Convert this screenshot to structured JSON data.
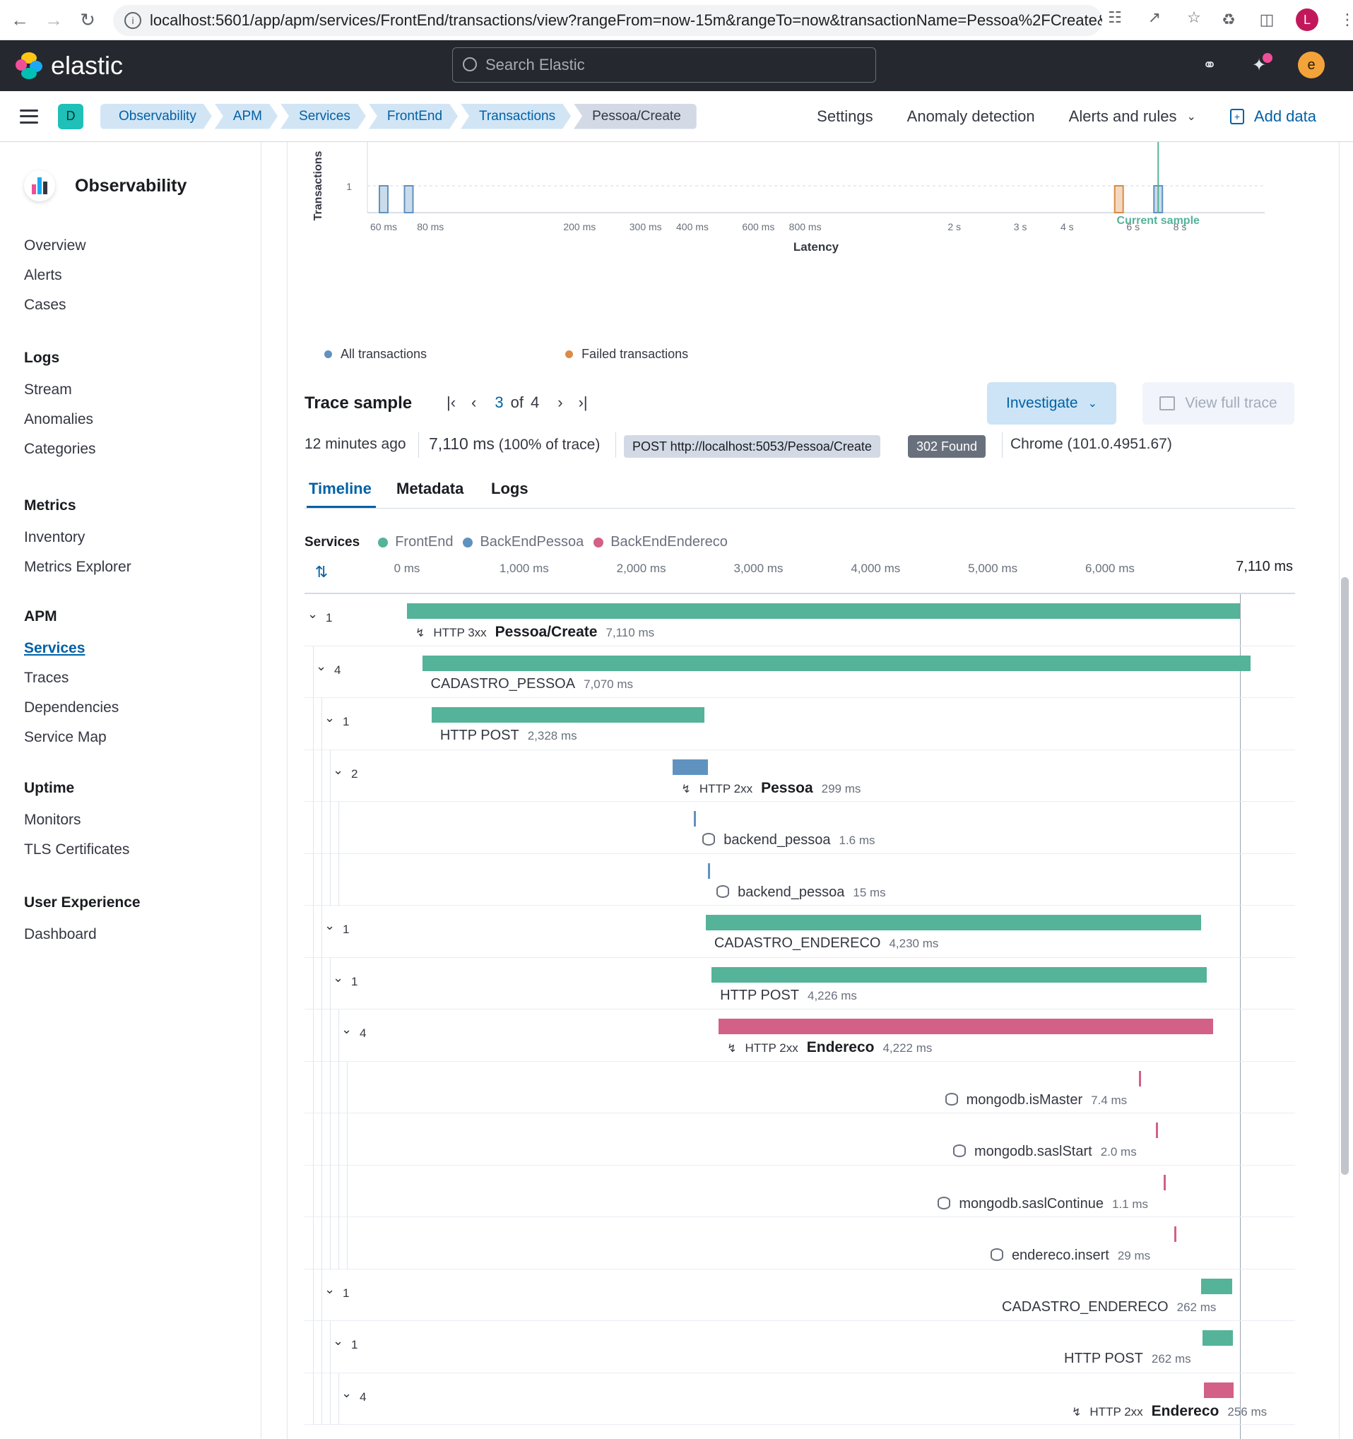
{
  "browser": {
    "url": "localhost:5601/app/apm/services/FrontEnd/transactions/view?rangeFrom=now-15m&rangeTo=now&transactionName=Pessoa%2FCreate&tra...",
    "profile_initial": "L"
  },
  "header": {
    "brand": "elastic",
    "search_placeholder": "Search Elastic",
    "user_initial": "e"
  },
  "breadcrumbs": {
    "space": "D",
    "items": [
      "Observability",
      "APM",
      "Services",
      "FrontEnd",
      "Transactions",
      "Pessoa/Create"
    ],
    "links": [
      "Settings",
      "Anomaly detection",
      "Alerts and rules",
      "Add data"
    ]
  },
  "sidebar": {
    "title": "Observability",
    "top": [
      "Overview",
      "Alerts",
      "Cases"
    ],
    "groups": [
      {
        "title": "Logs",
        "items": [
          "Stream",
          "Anomalies",
          "Categories"
        ]
      },
      {
        "title": "Metrics",
        "items": [
          "Inventory",
          "Metrics Explorer"
        ]
      },
      {
        "title": "APM",
        "items": [
          "Services",
          "Traces",
          "Dependencies",
          "Service Map"
        ]
      },
      {
        "title": "Uptime",
        "items": [
          "Monitors",
          "TLS Certificates"
        ]
      },
      {
        "title": "User Experience",
        "items": [
          "Dashboard"
        ]
      }
    ],
    "active": "Services"
  },
  "chart_data": {
    "type": "bar",
    "ylabel": "Transactions",
    "xlabel": "Latency",
    "x_scale": "log",
    "x_ticks": [
      "60 ms",
      "80 ms",
      "200 ms",
      "300 ms",
      "400 ms",
      "600 ms",
      "800 ms",
      "2 s",
      "3 s",
      "4 s",
      "6 s",
      "8 s"
    ],
    "y_ticks": [
      "1"
    ],
    "series": [
      {
        "name": "All transactions",
        "color": "#6092c0",
        "x": [
          "60 ms",
          "70 ms",
          "7 s"
        ],
        "values": [
          1,
          1,
          1
        ]
      },
      {
        "name": "Failed transactions",
        "color": "#da8b45",
        "x": [
          "5.5 s"
        ],
        "values": [
          1
        ]
      }
    ],
    "annotation": "Current sample",
    "legend": [
      "All transactions",
      "Failed transactions"
    ]
  },
  "trace": {
    "title": "Trace sample",
    "current": "3",
    "of": "of",
    "total": "4",
    "investigate": "Investigate",
    "view_full_trace": "View full trace",
    "time_ago": "12 minutes ago",
    "duration": "7,110 ms",
    "duration_pct": "(100% of trace)",
    "request": "POST http://localhost:5053/Pessoa/Create",
    "status": "302 Found",
    "agent": "Chrome (101.0.4951.67)",
    "tabs": [
      "Timeline",
      "Metadata",
      "Logs"
    ]
  },
  "timeline": {
    "services_label": "Services",
    "services": [
      {
        "name": "FrontEnd",
        "color": "#54b399"
      },
      {
        "name": "BackEndPessoa",
        "color": "#6092c0"
      },
      {
        "name": "BackEndEndereco",
        "color": "#d36086"
      }
    ],
    "axis": [
      "0 ms",
      "1,000 ms",
      "2,000 ms",
      "3,000 ms",
      "4,000 ms",
      "5,000 ms",
      "6,000 ms",
      "7,110 ms"
    ],
    "rows": [
      {
        "count": "1",
        "kind": "tx",
        "http": "HTTP 3xx",
        "name": "Pessoa/Create",
        "dur": "7,110 ms",
        "start": 0,
        "ms": 7110,
        "color": "#54b399"
      },
      {
        "count": "4",
        "kind": "span",
        "name": "CADASTRO_PESSOA",
        "dur": "7,070 ms",
        "start": 130,
        "ms": 7070,
        "color": "#54b399"
      },
      {
        "count": "1",
        "kind": "span",
        "name": "HTTP POST",
        "dur": "2,328 ms",
        "start": 210,
        "ms": 2328,
        "color": "#54b399"
      },
      {
        "count": "2",
        "kind": "tx",
        "http": "HTTP 2xx",
        "name": "Pessoa",
        "dur": "299 ms",
        "start": 2270,
        "ms": 299,
        "color": "#6092c0"
      },
      {
        "count": "",
        "kind": "db",
        "name": "backend_pessoa",
        "dur": "1.6 ms",
        "start": 2450,
        "ms": 1.6,
        "color": "#6092c0"
      },
      {
        "count": "",
        "kind": "db",
        "name": "backend_pessoa",
        "dur": "15 ms",
        "start": 2570,
        "ms": 15,
        "color": "#6092c0"
      },
      {
        "count": "1",
        "kind": "span",
        "name": "CADASTRO_ENDERECO",
        "dur": "4,230 ms",
        "start": 2550,
        "ms": 4230,
        "color": "#54b399"
      },
      {
        "count": "1",
        "kind": "span",
        "name": "HTTP POST",
        "dur": "4,226 ms",
        "start": 2600,
        "ms": 4226,
        "color": "#54b399"
      },
      {
        "count": "4",
        "kind": "tx",
        "http": "HTTP 2xx",
        "name": "Endereco",
        "dur": "4,222 ms",
        "start": 2660,
        "ms": 4222,
        "color": "#d36086"
      },
      {
        "count": "",
        "kind": "db",
        "name": "mongodb.isMaster",
        "dur": "7.4 ms",
        "start": 6250,
        "ms": 7.4,
        "color": "#d36086"
      },
      {
        "count": "",
        "kind": "db",
        "name": "mongodb.saslStart",
        "dur": "2.0 ms",
        "start": 6390,
        "ms": 2.0,
        "color": "#d36086"
      },
      {
        "count": "",
        "kind": "db",
        "name": "mongodb.saslContinue",
        "dur": "1.1 ms",
        "start": 6460,
        "ms": 1.1,
        "color": "#d36086"
      },
      {
        "count": "",
        "kind": "db",
        "name": "endereco.insert",
        "dur": "29 ms",
        "start": 6550,
        "ms": 29,
        "color": "#d36086"
      },
      {
        "count": "1",
        "kind": "span",
        "name": "CADASTRO_ENDERECO",
        "dur": "262 ms",
        "start": 6780,
        "ms": 262,
        "color": "#54b399"
      },
      {
        "count": "1",
        "kind": "span",
        "name": "HTTP POST",
        "dur": "262 ms",
        "start": 6790,
        "ms": 262,
        "color": "#54b399"
      },
      {
        "count": "4",
        "kind": "tx",
        "http": "HTTP 2xx",
        "name": "Endereco",
        "dur": "256 ms",
        "start": 6800,
        "ms": 256,
        "color": "#d36086"
      }
    ]
  }
}
